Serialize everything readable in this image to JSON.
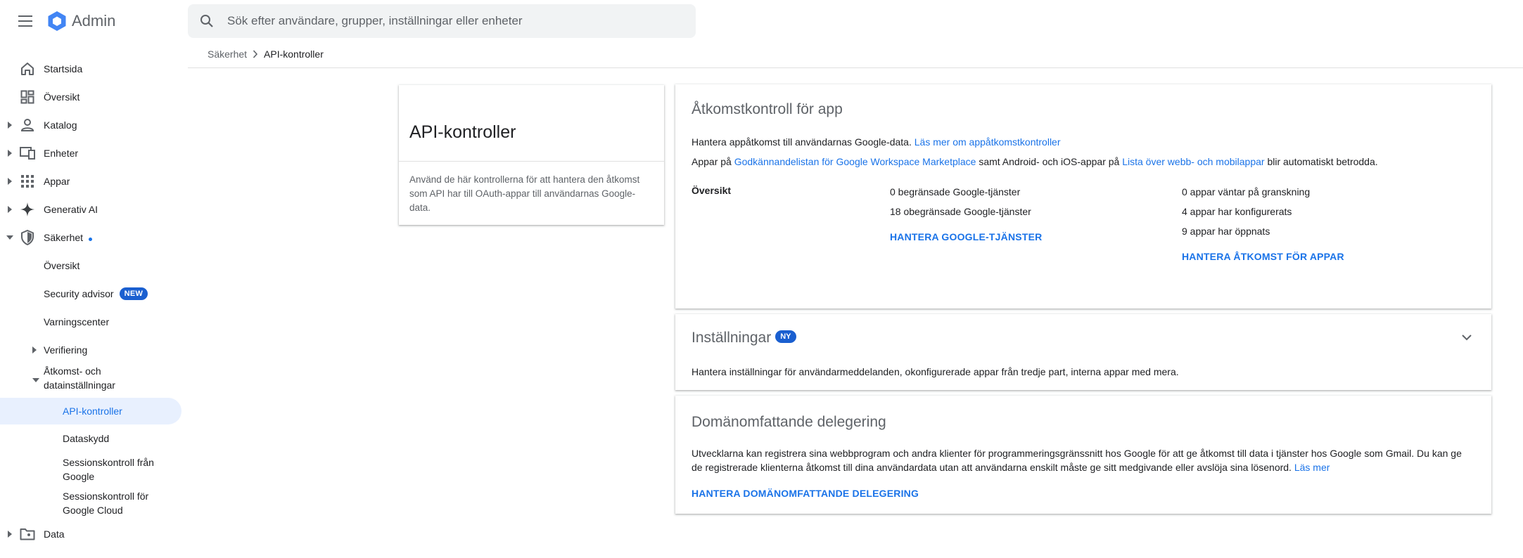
{
  "app": {
    "title": "Admin"
  },
  "search": {
    "placeholder": "Sök efter användare, grupper, inställningar eller enheter"
  },
  "breadcrumb": {
    "parent": "Säkerhet",
    "current": "API-kontroller"
  },
  "sidebar": {
    "items": [
      {
        "label": "Startsida",
        "icon": "home-icon"
      },
      {
        "label": "Översikt",
        "icon": "dashboard-icon"
      },
      {
        "label": "Katalog",
        "icon": "person-icon"
      },
      {
        "label": "Enheter",
        "icon": "devices-icon"
      },
      {
        "label": "Appar",
        "icon": "apps-grid-icon"
      },
      {
        "label": "Generativ AI",
        "icon": "sparkle-icon"
      },
      {
        "label": "Säkerhet",
        "icon": "shield-icon"
      }
    ],
    "security_sub": {
      "overview": "Översikt",
      "security_advisor": "Security advisor",
      "new_badge": "NEW",
      "alert_center": "Varningscenter",
      "verification": "Verifiering",
      "access_line1": "Åtkomst- och",
      "access_line2": "datainställningar",
      "api_controls": "API-kontroller",
      "data_protection": "Dataskydd",
      "session_google_1": "Sessionskontroll från",
      "session_google_2": "Google",
      "session_cloud_1": "Sessionskontroll för",
      "session_cloud_2": "Google Cloud"
    },
    "data": {
      "label": "Data",
      "icon": "folder-icon"
    }
  },
  "info_card": {
    "title": "API-kontroller",
    "description": "Använd de här kontrollerna för att hantera den åtkomst som API har till OAuth-appar till användarnas Google-data."
  },
  "app_access": {
    "title": "Åtkomstkontroll för app",
    "line1_text": "Hantera appåtkomst till användarnas Google-data. ",
    "line1_link": "Läs mer om appåtkomstkontroller",
    "line2_a": "Appar på ",
    "line2_link1": "Godkännandelistan för Google Workspace Marketplace",
    "line2_b": " samt Android- och iOS-appar på ",
    "line2_link2": "Lista över webb- och mobilappar",
    "line2_c": " blir automatiskt betrodda.",
    "overview_label": "Översikt",
    "restricted": "0 begränsade Google-tjänster",
    "unrestricted": "18 obegränsade Google-tjänster",
    "manage_services": "HANTERA GOOGLE-TJÄNSTER",
    "pending_review": "0 appar väntar på granskning",
    "configured": "4 appar har konfigurerats",
    "opened": "9 appar har öppnats",
    "manage_app_access": "HANTERA ÅTKOMST FÖR APPAR"
  },
  "settings": {
    "title": "Inställningar",
    "badge": "NY",
    "description": "Hantera inställningar för användarmeddelanden, okonfigurerade appar från tredje part, interna appar med mera."
  },
  "delegation": {
    "title": "Domänomfattande delegering",
    "text1": "Utvecklarna kan registrera sina webbprogram och andra klienter för programmeringsgränssnitt hos Google för att ge åtkomst till data i tjänster hos Google som Gmail. Du kan ge",
    "text2": "de registrerade klienterna åtkomst till dina användardata utan att användarna enskilt måste ge sitt medgivande eller avslöja sina lösenord. ",
    "link": "Läs mer",
    "manage": "HANTERA DOMÄNOMFATTANDE DELEGERING"
  }
}
